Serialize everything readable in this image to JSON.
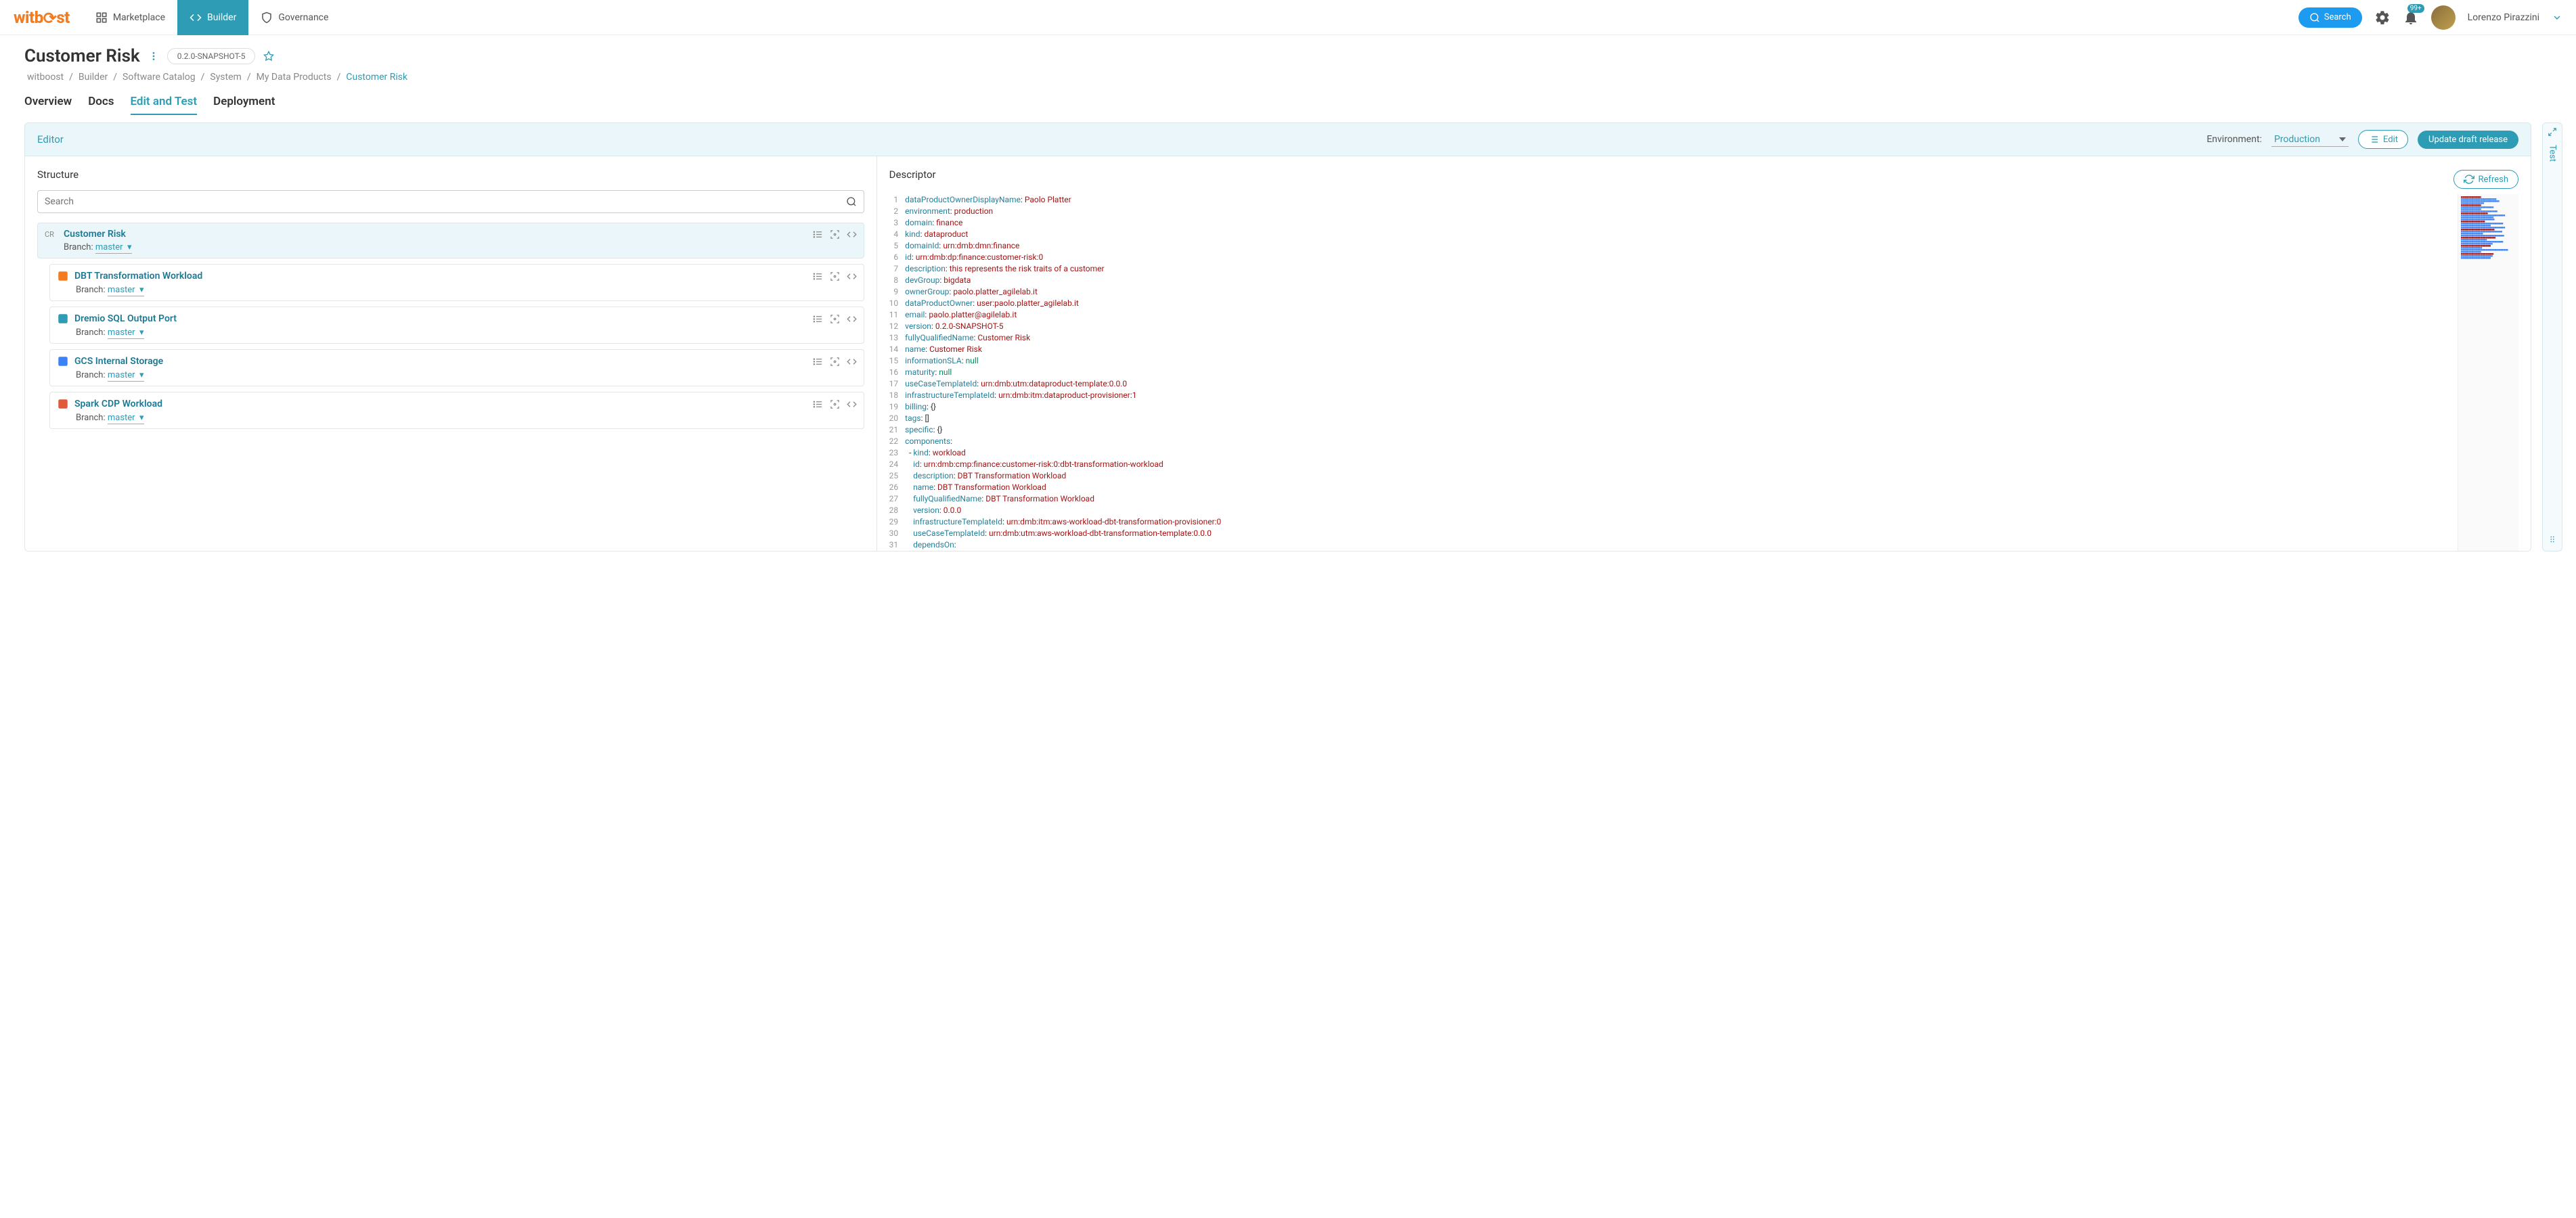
{
  "brand": "witboost",
  "nav": {
    "marketplace": "Marketplace",
    "builder": "Builder",
    "governance": "Governance"
  },
  "topbar": {
    "search": "Search",
    "badge": "99+",
    "user": "Lorenzo Pirazzini"
  },
  "page": {
    "title": "Customer Risk",
    "version": "0.2.0-SNAPSHOT-5"
  },
  "breadcrumb": [
    "witboost",
    "Builder",
    "Software Catalog",
    "System",
    "My Data Products",
    "Customer Risk"
  ],
  "tabs": [
    "Overview",
    "Docs",
    "Edit and Test",
    "Deployment"
  ],
  "panel": {
    "title": "Editor",
    "envLabel": "Environment:",
    "envValue": "Production",
    "edit": "Edit",
    "update": "Update draft release"
  },
  "structure": {
    "title": "Structure",
    "searchPlaceholder": "Search",
    "branchLabel": "Branch:",
    "branchValue": "master",
    "root": {
      "initials": "CR",
      "title": "Customer Risk"
    },
    "children": [
      {
        "title": "DBT Transformation Workload",
        "iconColor": "#f47c20"
      },
      {
        "title": "Dremio SQL Output Port",
        "iconColor": "#2d9cb4"
      },
      {
        "title": "GCS Internal Storage",
        "iconColor": "#3b82f6"
      },
      {
        "title": "Spark CDP Workload",
        "iconColor": "#e05b3c"
      }
    ]
  },
  "descriptor": {
    "title": "Descriptor",
    "refresh": "Refresh",
    "lines": [
      [
        [
          "k",
          "dataProductOwnerDisplayName"
        ],
        [
          "p",
          ": "
        ],
        [
          "v",
          "Paolo Platter"
        ]
      ],
      [
        [
          "k",
          "environment"
        ],
        [
          "p",
          ": "
        ],
        [
          "v",
          "production"
        ]
      ],
      [
        [
          "k",
          "domain"
        ],
        [
          "p",
          ": "
        ],
        [
          "v",
          "finance"
        ]
      ],
      [
        [
          "k",
          "kind"
        ],
        [
          "p",
          ": "
        ],
        [
          "v",
          "dataproduct"
        ]
      ],
      [
        [
          "k",
          "domainId"
        ],
        [
          "p",
          ": "
        ],
        [
          "v",
          "urn:dmb:dmn:finance"
        ]
      ],
      [
        [
          "k",
          "id"
        ],
        [
          "p",
          ": "
        ],
        [
          "v",
          "urn:dmb:dp:finance:customer-risk:0"
        ]
      ],
      [
        [
          "k",
          "description"
        ],
        [
          "p",
          ": "
        ],
        [
          "v",
          "this represents the risk traits of a customer"
        ]
      ],
      [
        [
          "k",
          "devGroup"
        ],
        [
          "p",
          ": "
        ],
        [
          "v",
          "bigdata"
        ]
      ],
      [
        [
          "k",
          "ownerGroup"
        ],
        [
          "p",
          ": "
        ],
        [
          "v",
          "paolo.platter_agilelab.it"
        ]
      ],
      [
        [
          "k",
          "dataProductOwner"
        ],
        [
          "p",
          ": "
        ],
        [
          "v",
          "user:paolo.platter_agilelab.it"
        ]
      ],
      [
        [
          "k",
          "email"
        ],
        [
          "p",
          ": "
        ],
        [
          "v",
          "paolo.platter@agilelab.it"
        ]
      ],
      [
        [
          "k",
          "version"
        ],
        [
          "p",
          ": "
        ],
        [
          "v",
          "0.2.0-SNAPSHOT-5"
        ]
      ],
      [
        [
          "k",
          "fullyQualifiedName"
        ],
        [
          "p",
          ": "
        ],
        [
          "v",
          "Customer Risk"
        ]
      ],
      [
        [
          "k",
          "name"
        ],
        [
          "p",
          ": "
        ],
        [
          "v",
          "Customer Risk"
        ]
      ],
      [
        [
          "k",
          "informationSLA"
        ],
        [
          "p",
          ": "
        ],
        [
          "n",
          "null"
        ]
      ],
      [
        [
          "k",
          "maturity"
        ],
        [
          "p",
          ": "
        ],
        [
          "n",
          "null"
        ]
      ],
      [
        [
          "k",
          "useCaseTemplateId"
        ],
        [
          "p",
          ": "
        ],
        [
          "v",
          "urn:dmb:utm:dataproduct-template:0.0.0"
        ]
      ],
      [
        [
          "k",
          "infrastructureTemplateId"
        ],
        [
          "p",
          ": "
        ],
        [
          "v",
          "urn:dmb:itm:dataproduct-provisioner:1"
        ]
      ],
      [
        [
          "k",
          "billing"
        ],
        [
          "p",
          ": "
        ],
        [
          "p",
          "{}"
        ]
      ],
      [
        [
          "k",
          "tags"
        ],
        [
          "p",
          ": "
        ],
        [
          "p",
          "[]"
        ]
      ],
      [
        [
          "k",
          "specific"
        ],
        [
          "p",
          ": "
        ],
        [
          "p",
          "{}"
        ]
      ],
      [
        [
          "k",
          "components"
        ],
        [
          "p",
          ":"
        ]
      ],
      [
        [
          "p",
          "  - "
        ],
        [
          "k",
          "kind"
        ],
        [
          "p",
          ": "
        ],
        [
          "v",
          "workload"
        ]
      ],
      [
        [
          "p",
          "    "
        ],
        [
          "k",
          "id"
        ],
        [
          "p",
          ": "
        ],
        [
          "v",
          "urn:dmb:cmp:finance:customer-risk:0:dbt-transformation-workload"
        ]
      ],
      [
        [
          "p",
          "    "
        ],
        [
          "k",
          "description"
        ],
        [
          "p",
          ": "
        ],
        [
          "v",
          "DBT Transformation Workload"
        ]
      ],
      [
        [
          "p",
          "    "
        ],
        [
          "k",
          "name"
        ],
        [
          "p",
          ": "
        ],
        [
          "v",
          "DBT Transformation Workload"
        ]
      ],
      [
        [
          "p",
          "    "
        ],
        [
          "k",
          "fullyQualifiedName"
        ],
        [
          "p",
          ": "
        ],
        [
          "v",
          "DBT Transformation Workload"
        ]
      ],
      [
        [
          "p",
          "    "
        ],
        [
          "k",
          "version"
        ],
        [
          "p",
          ": "
        ],
        [
          "v",
          "0.0.0"
        ]
      ],
      [
        [
          "p",
          "    "
        ],
        [
          "k",
          "infrastructureTemplateId"
        ],
        [
          "p",
          ": "
        ],
        [
          "v",
          "urn:dmb:itm:aws-workload-dbt-transformation-provisioner:0"
        ]
      ],
      [
        [
          "p",
          "    "
        ],
        [
          "k",
          "useCaseTemplateId"
        ],
        [
          "p",
          ": "
        ],
        [
          "v",
          "urn:dmb:utm:aws-workload-dbt-transformation-template:0.0.0"
        ]
      ],
      [
        [
          "p",
          "    "
        ],
        [
          "k",
          "dependsOn"
        ],
        [
          "p",
          ":"
        ]
      ]
    ]
  },
  "sideRail": "Test"
}
